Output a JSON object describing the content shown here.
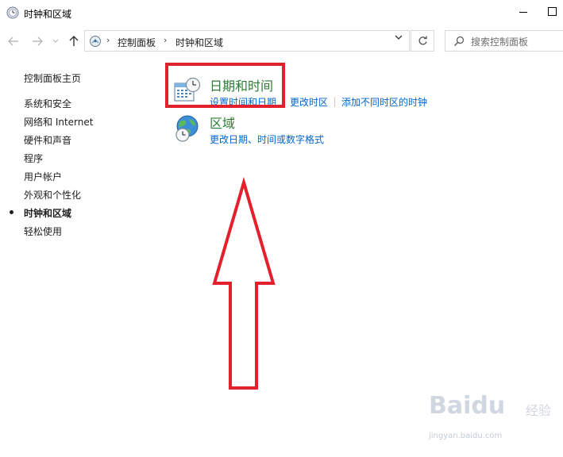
{
  "window": {
    "title": "时钟和区域"
  },
  "navigation": {
    "breadcrumbs": [
      "控制面板",
      "时钟和区域"
    ],
    "search_placeholder": "搜索控制面板"
  },
  "sidebar": {
    "home": "控制面板主页",
    "items": [
      {
        "label": "系统和安全",
        "active": false
      },
      {
        "label": "网络和 Internet",
        "active": false
      },
      {
        "label": "硬件和声音",
        "active": false
      },
      {
        "label": "程序",
        "active": false
      },
      {
        "label": "用户帐户",
        "active": false
      },
      {
        "label": "外观和个性化",
        "active": false
      },
      {
        "label": "时钟和区域",
        "active": true
      },
      {
        "label": "轻松使用",
        "active": false
      }
    ]
  },
  "main": {
    "categories": [
      {
        "title": "日期和时间",
        "icon": "calendar-clock-icon",
        "links": [
          "设置时间和日期",
          "更改时区",
          "添加不同时区的时钟"
        ]
      },
      {
        "title": "区域",
        "icon": "globe-clock-icon",
        "links": [
          "更改日期、时间或数字格式"
        ]
      }
    ]
  },
  "annotation": {
    "highlight_color": "#e3202c"
  },
  "watermark": {
    "brand": "Baidu",
    "brand_cn": "经验",
    "url": "jingyan.baidu.com"
  },
  "colors": {
    "category_title": "#2a7d32",
    "link": "#0066cc"
  }
}
